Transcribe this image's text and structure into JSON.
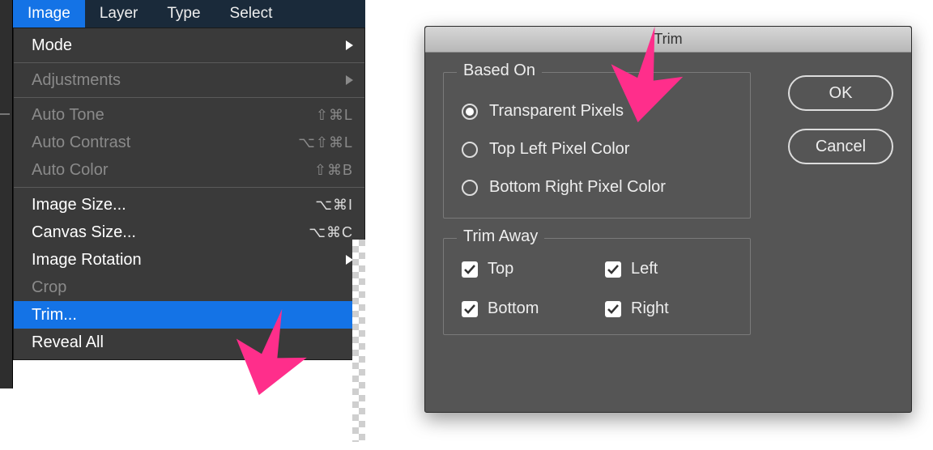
{
  "menubar": {
    "image": "Image",
    "layer": "Layer",
    "type": "Type",
    "select": "Select"
  },
  "menu": {
    "mode": "Mode",
    "adjustments": "Adjustments",
    "auto_tone": {
      "label": "Auto Tone",
      "shortcut": "⇧⌘L"
    },
    "auto_contrast": {
      "label": "Auto Contrast",
      "shortcut": "⌥⇧⌘L"
    },
    "auto_color": {
      "label": "Auto Color",
      "shortcut": "⇧⌘B"
    },
    "image_size": {
      "label": "Image Size...",
      "shortcut": "⌥⌘I"
    },
    "canvas_size": {
      "label": "Canvas Size...",
      "shortcut": "⌥⌘C"
    },
    "image_rotation": "Image Rotation",
    "crop": "Crop",
    "trim": "Trim...",
    "reveal_all": "Reveal All"
  },
  "dialog": {
    "title": "Trim",
    "based_on": {
      "legend": "Based On",
      "transparent": "Transparent Pixels",
      "top_left": "Top Left Pixel Color",
      "bottom_right": "Bottom Right Pixel Color"
    },
    "trim_away": {
      "legend": "Trim Away",
      "top": "Top",
      "left": "Left",
      "bottom": "Bottom",
      "right": "Right"
    },
    "ok": "OK",
    "cancel": "Cancel"
  }
}
